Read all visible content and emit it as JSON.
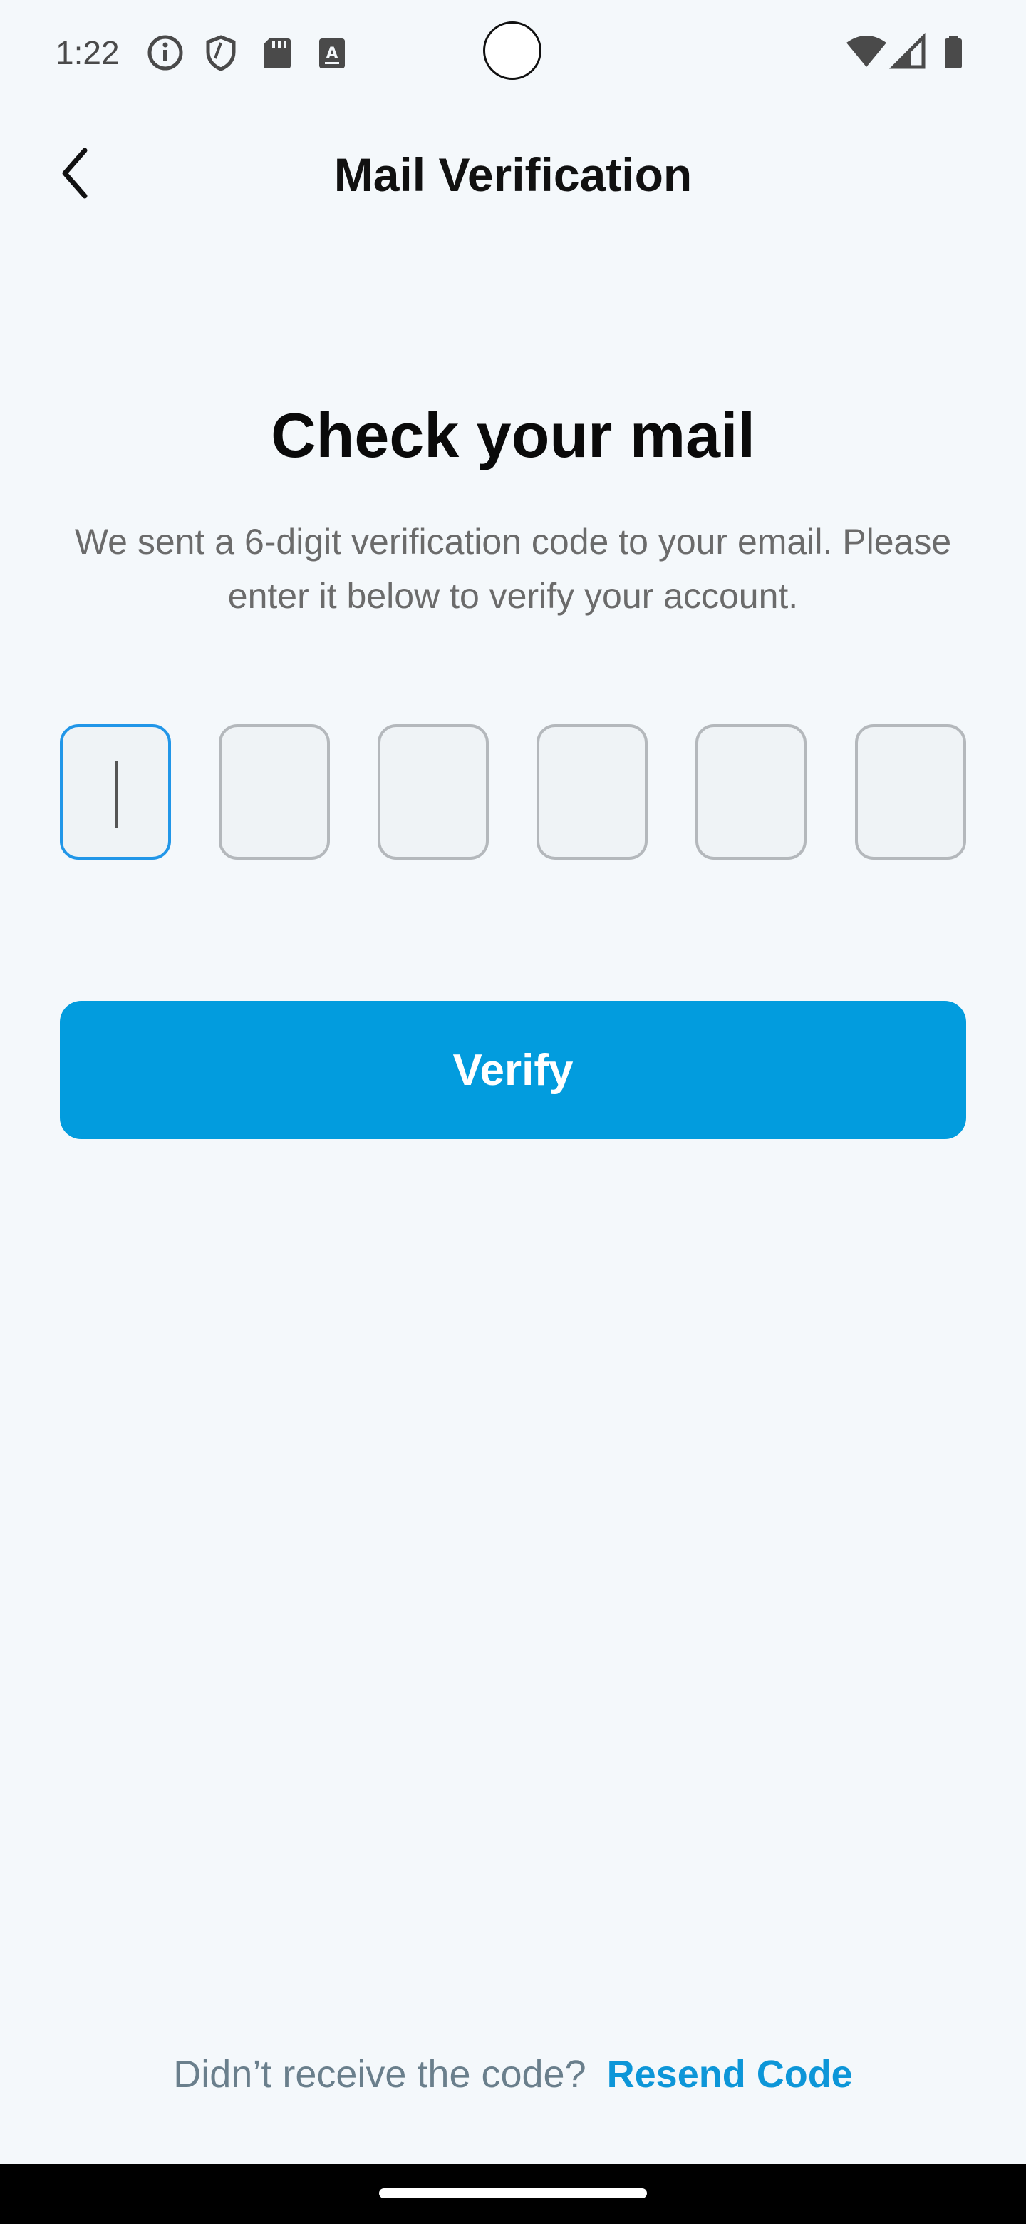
{
  "status_bar": {
    "time": "1:22",
    "icons": [
      "info-icon",
      "shield-icon",
      "sd-card-icon",
      "keyboard-a-icon",
      "wifi-icon",
      "signal-icon",
      "battery-icon"
    ]
  },
  "header": {
    "back_icon": "chevron-left-icon",
    "title": "Mail Verification"
  },
  "main": {
    "heading": "Check your mail",
    "subtext": "We sent a 6-digit verification code to your email. Please enter it below to verify your account.",
    "otp": {
      "digit_count": 6,
      "values": [
        "",
        "",
        "",
        "",
        "",
        ""
      ],
      "active_index": 0
    },
    "verify_label": "Verify"
  },
  "footer": {
    "prompt": "Didn’t receive the code?",
    "link": "Resend Code"
  },
  "colors": {
    "background": "#f4f8fb",
    "primary": "#029cde",
    "active_border": "#2196e8",
    "inactive_border": "#b4b8bc",
    "link": "#0d96d8"
  }
}
